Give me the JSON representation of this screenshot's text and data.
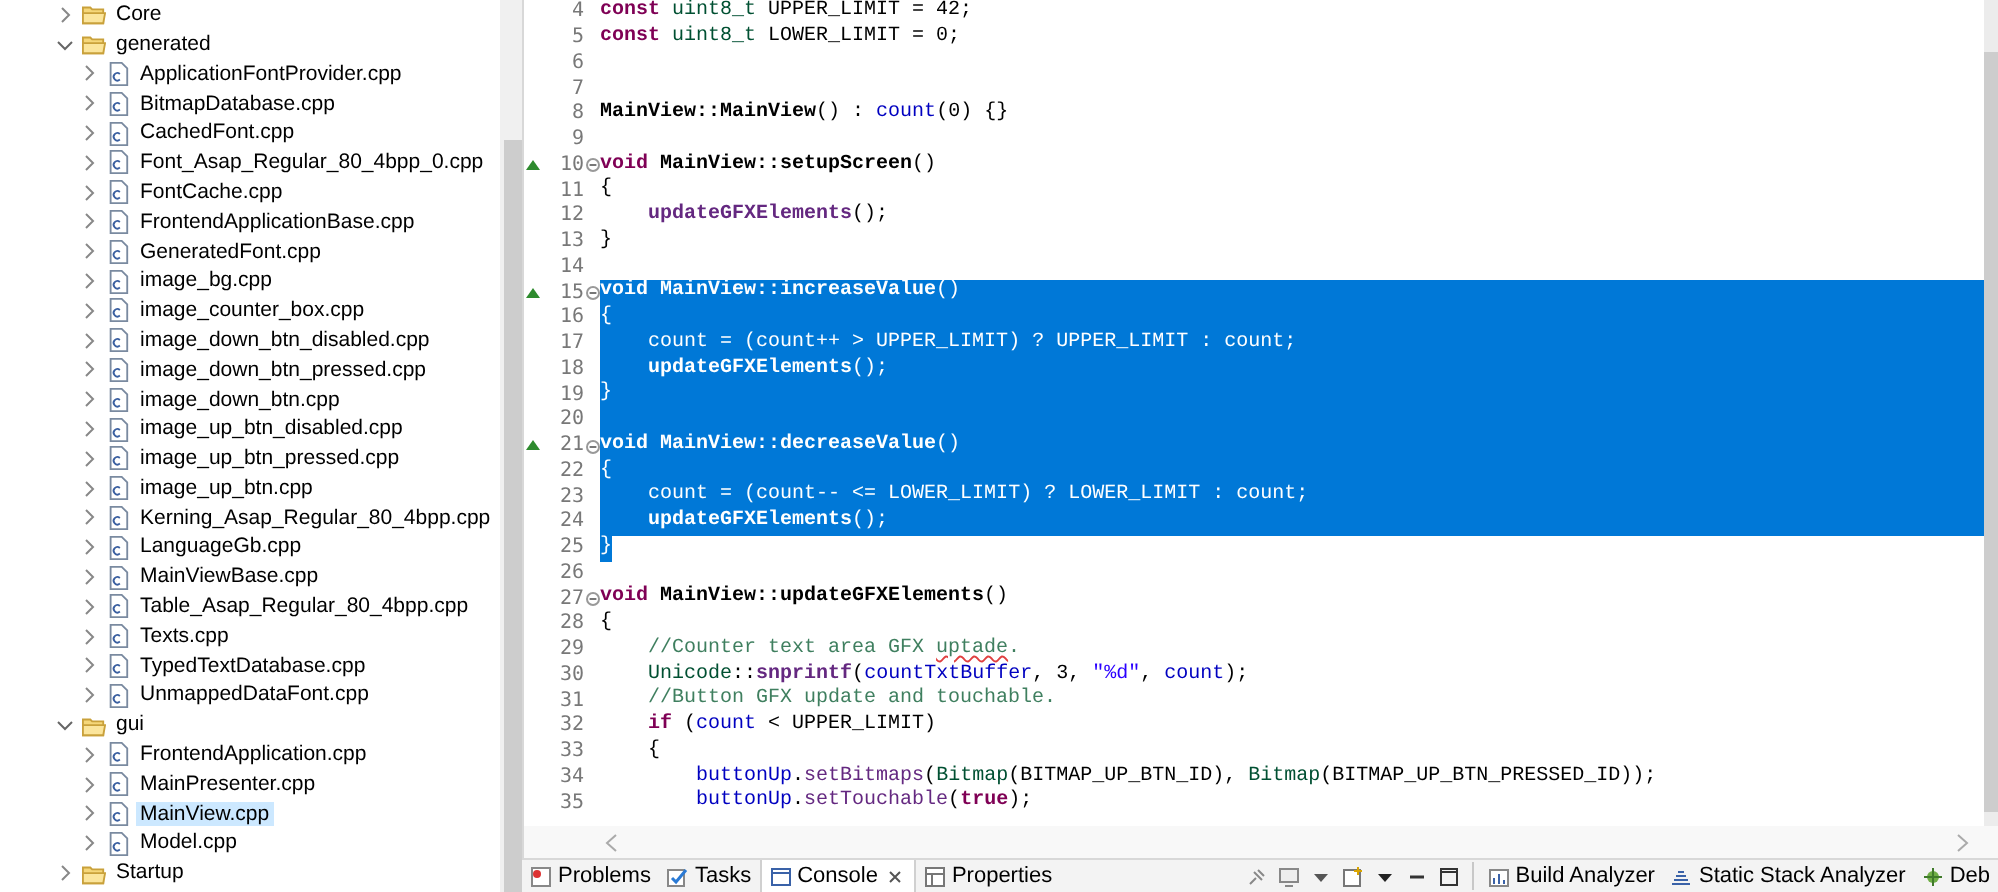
{
  "project_tree": {
    "items": [
      {
        "label": "Core",
        "kind": "folder",
        "expanded": false,
        "selected": false
      },
      {
        "label": "generated",
        "kind": "folder",
        "expanded": true,
        "selected": false,
        "children": [
          {
            "label": "ApplicationFontProvider.cpp",
            "kind": "file",
            "expanded": false,
            "selected": false
          },
          {
            "label": "BitmapDatabase.cpp",
            "kind": "file",
            "expanded": false,
            "selected": false
          },
          {
            "label": "CachedFont.cpp",
            "kind": "file",
            "expanded": false,
            "selected": false
          },
          {
            "label": "Font_Asap_Regular_80_4bpp_0.cpp",
            "kind": "file",
            "expanded": false,
            "selected": false
          },
          {
            "label": "FontCache.cpp",
            "kind": "file",
            "expanded": false,
            "selected": false
          },
          {
            "label": "FrontendApplicationBase.cpp",
            "kind": "file",
            "expanded": false,
            "selected": false
          },
          {
            "label": "GeneratedFont.cpp",
            "kind": "file",
            "expanded": false,
            "selected": false
          },
          {
            "label": "image_bg.cpp",
            "kind": "file",
            "expanded": false,
            "selected": false
          },
          {
            "label": "image_counter_box.cpp",
            "kind": "file",
            "expanded": false,
            "selected": false
          },
          {
            "label": "image_down_btn_disabled.cpp",
            "kind": "file",
            "expanded": false,
            "selected": false
          },
          {
            "label": "image_down_btn_pressed.cpp",
            "kind": "file",
            "expanded": false,
            "selected": false
          },
          {
            "label": "image_down_btn.cpp",
            "kind": "file",
            "expanded": false,
            "selected": false
          },
          {
            "label": "image_up_btn_disabled.cpp",
            "kind": "file",
            "expanded": false,
            "selected": false
          },
          {
            "label": "image_up_btn_pressed.cpp",
            "kind": "file",
            "expanded": false,
            "selected": false
          },
          {
            "label": "image_up_btn.cpp",
            "kind": "file",
            "expanded": false,
            "selected": false
          },
          {
            "label": "Kerning_Asap_Regular_80_4bpp.cpp",
            "kind": "file",
            "expanded": false,
            "selected": false
          },
          {
            "label": "LanguageGb.cpp",
            "kind": "file",
            "expanded": false,
            "selected": false
          },
          {
            "label": "MainViewBase.cpp",
            "kind": "file",
            "expanded": false,
            "selected": false
          },
          {
            "label": "Table_Asap_Regular_80_4bpp.cpp",
            "kind": "file",
            "expanded": false,
            "selected": false
          },
          {
            "label": "Texts.cpp",
            "kind": "file",
            "expanded": false,
            "selected": false
          },
          {
            "label": "TypedTextDatabase.cpp",
            "kind": "file",
            "expanded": false,
            "selected": false
          },
          {
            "label": "UnmappedDataFont.cpp",
            "kind": "file",
            "expanded": false,
            "selected": false
          }
        ]
      },
      {
        "label": "gui",
        "kind": "folder",
        "expanded": true,
        "selected": false,
        "children": [
          {
            "label": "FrontendApplication.cpp",
            "kind": "file",
            "expanded": false,
            "selected": false
          },
          {
            "label": "MainPresenter.cpp",
            "kind": "file",
            "expanded": false,
            "selected": false
          },
          {
            "label": "MainView.cpp",
            "kind": "file",
            "expanded": false,
            "selected": true
          },
          {
            "label": "Model.cpp",
            "kind": "file",
            "expanded": false,
            "selected": false
          }
        ]
      },
      {
        "label": "Startup",
        "kind": "folder",
        "expanded": false,
        "selected": false
      }
    ]
  },
  "editor": {
    "lines": [
      {
        "number": "4",
        "override": false,
        "fold": false,
        "selected": false,
        "partial": false,
        "segments": [
          {
            "kind": "kw",
            "text": "const"
          },
          {
            "kind": "type",
            "text": " uint8_t"
          },
          {
            "kind": "plain",
            "text": " UPPER_LIMIT = 42;"
          }
        ]
      },
      {
        "number": "5",
        "override": false,
        "fold": false,
        "selected": false,
        "partial": false,
        "segments": [
          {
            "kind": "kw",
            "text": "const"
          },
          {
            "kind": "type",
            "text": " uint8_t"
          },
          {
            "kind": "plain",
            "text": " LOWER_LIMIT = 0;"
          }
        ]
      },
      {
        "number": "6",
        "override": false,
        "fold": false,
        "selected": false,
        "partial": false
      },
      {
        "number": "7",
        "override": false,
        "fold": false,
        "selected": false,
        "partial": false
      },
      {
        "number": "8",
        "override": false,
        "fold": false,
        "selected": false,
        "partial": false,
        "segments": [
          {
            "kind": "decl",
            "text": "MainView::MainView"
          },
          {
            "kind": "plain",
            "text": "() : "
          },
          {
            "kind": "field",
            "text": "count"
          },
          {
            "kind": "plain",
            "text": "(0) {}"
          }
        ]
      },
      {
        "number": "9",
        "override": false,
        "fold": false,
        "selected": false,
        "partial": false
      },
      {
        "number": "10",
        "override": true,
        "fold": true,
        "selected": false,
        "partial": false,
        "segments": [
          {
            "kind": "kw",
            "text": "void"
          },
          {
            "kind": "decl",
            "text": " MainView::setupScreen"
          },
          {
            "kind": "plain",
            "text": "()"
          }
        ]
      },
      {
        "number": "11",
        "override": false,
        "fold": false,
        "selected": false,
        "partial": false,
        "segments": [
          {
            "kind": "plain",
            "text": "{"
          }
        ]
      },
      {
        "number": "12",
        "override": false,
        "fold": false,
        "selected": false,
        "partial": false,
        "segments": [
          {
            "kind": "call",
            "text": "    updateGFXElements"
          },
          {
            "kind": "plain",
            "text": "();"
          }
        ]
      },
      {
        "number": "13",
        "override": false,
        "fold": false,
        "selected": false,
        "partial": false,
        "segments": [
          {
            "kind": "plain",
            "text": "}"
          }
        ]
      },
      {
        "number": "14",
        "override": false,
        "fold": false,
        "selected": false,
        "partial": false
      },
      {
        "number": "15",
        "override": true,
        "fold": true,
        "selected": true,
        "partial": false,
        "segments": [
          {
            "kind": "kw",
            "text": "void"
          },
          {
            "kind": "decl",
            "text": " MainView::increaseValue"
          },
          {
            "kind": "plain",
            "text": "()"
          }
        ]
      },
      {
        "number": "16",
        "override": false,
        "fold": false,
        "selected": true,
        "partial": false,
        "segments": [
          {
            "kind": "plain",
            "text": "{"
          }
        ]
      },
      {
        "number": "17",
        "override": false,
        "fold": false,
        "selected": true,
        "partial": false,
        "segments": [
          {
            "kind": "field",
            "text": "    count"
          },
          {
            "kind": "plain",
            "text": " = ("
          },
          {
            "kind": "field",
            "text": "count"
          },
          {
            "kind": "plain",
            "text": "++ > UPPER_LIMIT) ? UPPER_LIMIT : "
          },
          {
            "kind": "field",
            "text": "count"
          },
          {
            "kind": "plain",
            "text": ";"
          }
        ]
      },
      {
        "number": "18",
        "override": false,
        "fold": false,
        "selected": true,
        "partial": false,
        "segments": [
          {
            "kind": "call",
            "text": "    updateGFXElements"
          },
          {
            "kind": "plain",
            "text": "();"
          }
        ]
      },
      {
        "number": "19",
        "override": false,
        "fold": false,
        "selected": true,
        "partial": false,
        "segments": [
          {
            "kind": "plain",
            "text": "}"
          }
        ]
      },
      {
        "number": "20",
        "override": false,
        "fold": false,
        "selected": true,
        "partial": false
      },
      {
        "number": "21",
        "override": true,
        "fold": true,
        "selected": true,
        "partial": false,
        "segments": [
          {
            "kind": "kw",
            "text": "void"
          },
          {
            "kind": "decl",
            "text": " MainView::decreaseValue"
          },
          {
            "kind": "plain",
            "text": "()"
          }
        ]
      },
      {
        "number": "22",
        "override": false,
        "fold": false,
        "selected": true,
        "partial": false,
        "segments": [
          {
            "kind": "plain",
            "text": "{"
          }
        ]
      },
      {
        "number": "23",
        "override": false,
        "fold": false,
        "selected": true,
        "partial": false,
        "segments": [
          {
            "kind": "field",
            "text": "    count"
          },
          {
            "kind": "plain",
            "text": " = ("
          },
          {
            "kind": "field",
            "text": "count"
          },
          {
            "kind": "plain",
            "text": "-- <= LOWER_LIMIT) ? LOWER_LIMIT : "
          },
          {
            "kind": "field",
            "text": "count"
          },
          {
            "kind": "plain",
            "text": ";"
          }
        ]
      },
      {
        "number": "24",
        "override": false,
        "fold": false,
        "selected": true,
        "partial": false,
        "segments": [
          {
            "kind": "call",
            "text": "    updateGFXElements"
          },
          {
            "kind": "plain",
            "text": "();"
          }
        ]
      },
      {
        "number": "25",
        "override": false,
        "fold": false,
        "selected": false,
        "partial": true,
        "segments": [
          {
            "kind": "plain",
            "text": "}"
          }
        ]
      },
      {
        "number": "26",
        "override": false,
        "fold": false,
        "selected": false,
        "partial": false
      },
      {
        "number": "27",
        "override": false,
        "fold": true,
        "selected": false,
        "partial": false,
        "segments": [
          {
            "kind": "kw",
            "text": "void"
          },
          {
            "kind": "decl",
            "text": " MainView::updateGFXElements"
          },
          {
            "kind": "plain",
            "text": "()"
          }
        ]
      },
      {
        "number": "28",
        "override": false,
        "fold": false,
        "selected": false,
        "partial": false,
        "segments": [
          {
            "kind": "plain",
            "text": "{"
          }
        ]
      },
      {
        "number": "29",
        "override": false,
        "fold": false,
        "selected": false,
        "partial": false,
        "segments": [
          {
            "kind": "comment",
            "text": "    //Counter text area GFX "
          },
          {
            "kind": "misspelled",
            "text": "uptade"
          },
          {
            "kind": "comment",
            "text": "."
          }
        ]
      },
      {
        "number": "30",
        "override": false,
        "fold": false,
        "selected": false,
        "partial": false,
        "segments": [
          {
            "kind": "type",
            "text": "    Unicode"
          },
          {
            "kind": "plain",
            "text": "::"
          },
          {
            "kind": "call",
            "text": "snprintf"
          },
          {
            "kind": "plain",
            "text": "("
          },
          {
            "kind": "field",
            "text": "countTxtBuffer"
          },
          {
            "kind": "plain",
            "text": ", 3, "
          },
          {
            "kind": "string",
            "text": "\"%d\""
          },
          {
            "kind": "plain",
            "text": ", "
          },
          {
            "kind": "field",
            "text": "count"
          },
          {
            "kind": "plain",
            "text": ");"
          }
        ]
      },
      {
        "number": "31",
        "override": false,
        "fold": false,
        "selected": false,
        "partial": false,
        "segments": [
          {
            "kind": "comment",
            "text": "    //Button GFX update and touchable."
          }
        ]
      },
      {
        "number": "32",
        "override": false,
        "fold": false,
        "selected": false,
        "partial": false,
        "segments": [
          {
            "kind": "kw",
            "text": "    if"
          },
          {
            "kind": "plain",
            "text": " ("
          },
          {
            "kind": "field",
            "text": "count"
          },
          {
            "kind": "plain",
            "text": " < UPPER_LIMIT)"
          }
        ]
      },
      {
        "number": "33",
        "override": false,
        "fold": false,
        "selected": false,
        "partial": false,
        "segments": [
          {
            "kind": "plain",
            "text": "    {"
          }
        ]
      },
      {
        "number": "34",
        "override": false,
        "fold": false,
        "selected": false,
        "partial": false,
        "segments": [
          {
            "kind": "field",
            "text": "        buttonUp"
          },
          {
            "kind": "plain",
            "text": "."
          },
          {
            "kind": "method",
            "text": "setBitmaps"
          },
          {
            "kind": "plain",
            "text": "("
          },
          {
            "kind": "type",
            "text": "Bitmap"
          },
          {
            "kind": "plain",
            "text": "(BITMAP_UP_BTN_ID), "
          },
          {
            "kind": "type",
            "text": "Bitmap"
          },
          {
            "kind": "plain",
            "text": "(BITMAP_UP_BTN_PRESSED_ID));"
          }
        ]
      },
      {
        "number": "35",
        "override": false,
        "fold": false,
        "selected": false,
        "partial": false,
        "segments": [
          {
            "kind": "field",
            "text": "        buttonUp"
          },
          {
            "kind": "plain",
            "text": "."
          },
          {
            "kind": "method",
            "text": "setTouchable"
          },
          {
            "kind": "plain",
            "text": "("
          },
          {
            "kind": "kw",
            "text": "true"
          },
          {
            "kind": "plain",
            "text": ");"
          }
        ]
      }
    ]
  },
  "bottom_tabs": [
    {
      "label": "Problems",
      "kind": "problems",
      "selected": false,
      "closable": false
    },
    {
      "label": "Tasks",
      "kind": "tasks",
      "selected": false,
      "closable": false
    },
    {
      "label": "Console",
      "kind": "console",
      "selected": true,
      "closable": true
    },
    {
      "label": "Properties",
      "kind": "properties",
      "selected": false,
      "closable": false
    }
  ],
  "analyzer_tabs": [
    {
      "label": "Build Analyzer",
      "kind": "build",
      "selected": false
    },
    {
      "label": "Static Stack Analyzer",
      "kind": "stack",
      "selected": false
    },
    {
      "label": "Deb",
      "kind": "debug",
      "selected": false
    }
  ]
}
